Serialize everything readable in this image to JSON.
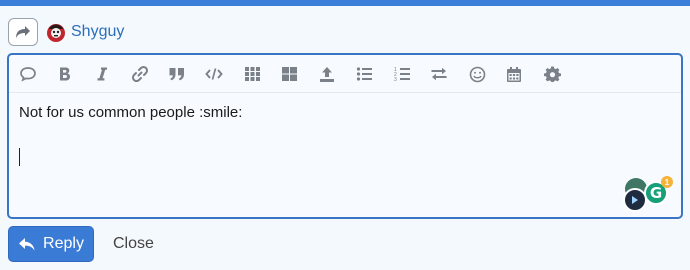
{
  "header": {
    "username": "Shyguy",
    "reply_icon": "share-arrow-icon",
    "avatar_icon": "avatar-icon"
  },
  "toolbar": {
    "buttons": [
      {
        "name": "speech-bubble-icon"
      },
      {
        "name": "bold-icon"
      },
      {
        "name": "italic-icon"
      },
      {
        "name": "link-icon"
      },
      {
        "name": "quote-icon"
      },
      {
        "name": "code-icon"
      },
      {
        "name": "table-grid-icon"
      },
      {
        "name": "grid-icon"
      },
      {
        "name": "upload-icon"
      },
      {
        "name": "bullet-list-icon"
      },
      {
        "name": "numbered-list-icon"
      },
      {
        "name": "swap-arrows-icon"
      },
      {
        "name": "smiley-icon"
      },
      {
        "name": "calendar-icon"
      },
      {
        "name": "gear-icon"
      }
    ]
  },
  "editor": {
    "text": "Not for us common people :smile:"
  },
  "widgets": {
    "grammarly_letter": "G",
    "grammarly_count": "1"
  },
  "actions": {
    "reply_label": "Reply",
    "close_label": "Close"
  },
  "colors": {
    "accent": "#3a7bd5",
    "username": "#2c6dba",
    "border": "#3a74c4"
  }
}
